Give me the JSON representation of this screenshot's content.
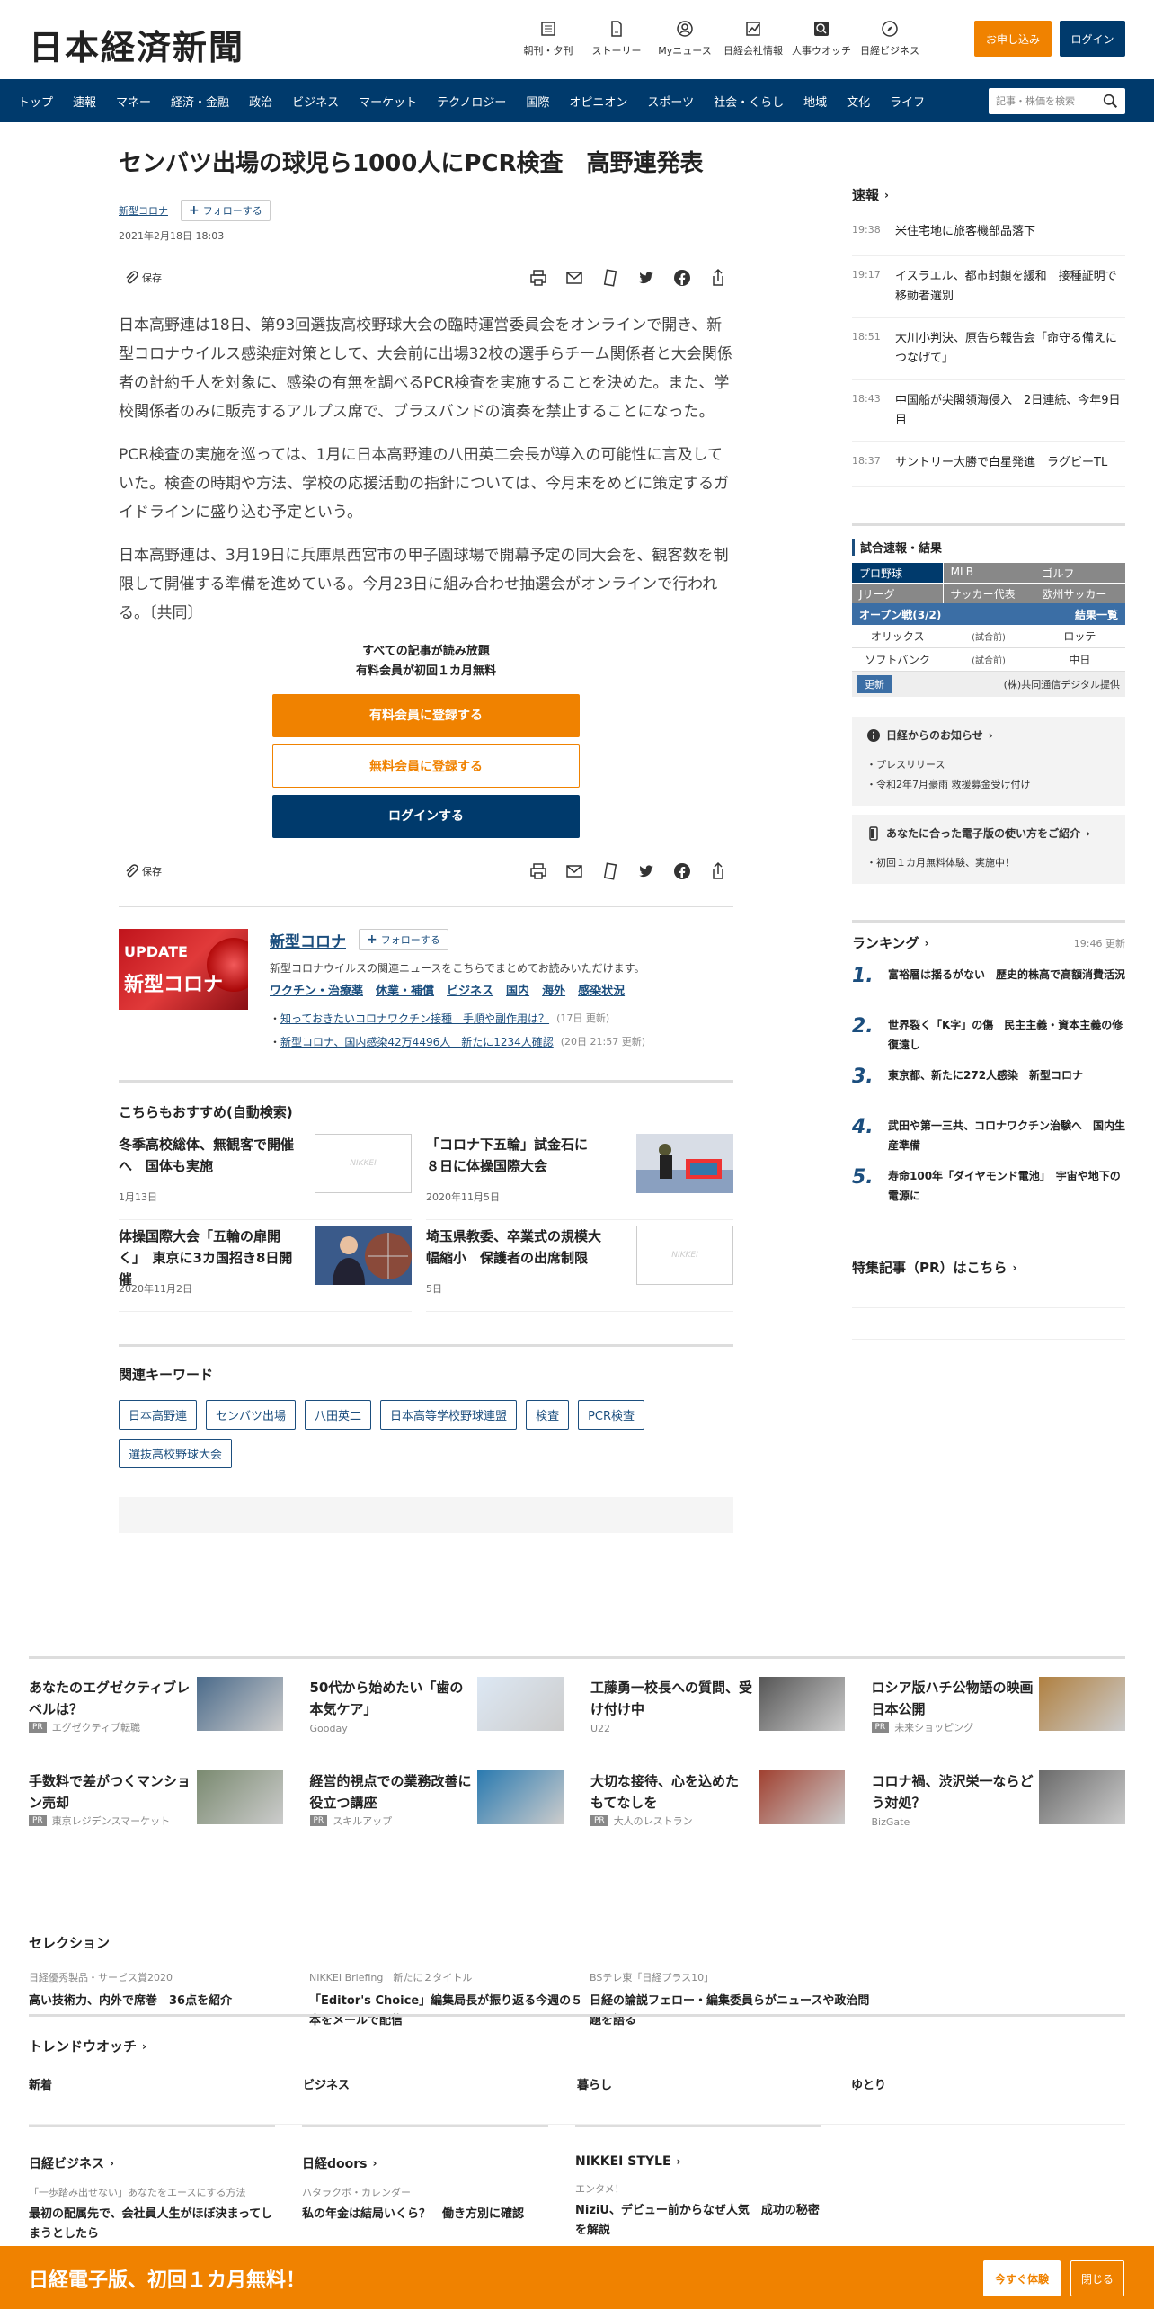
{
  "header": {
    "logo": "日本経済新聞",
    "tools": [
      {
        "label": "朝刊・夕刊",
        "icon": "newspaper-icon"
      },
      {
        "label": "ストーリー",
        "icon": "document-icon"
      },
      {
        "label": "Myニュース",
        "icon": "user-icon"
      },
      {
        "label": "日経会社情報",
        "icon": "chart-icon"
      },
      {
        "label": "人事ウオッチ",
        "icon": "search-person-icon"
      },
      {
        "label": "日経ビジネス",
        "icon": "compass-icon"
      }
    ],
    "subscribe_label": "お申し込み",
    "login_label": "ログイン"
  },
  "nav": {
    "items": [
      "トップ",
      "速報",
      "マネー",
      "経済・金融",
      "政治",
      "ビジネス",
      "マーケット",
      "テクノロジー",
      "国際",
      "オピニオン",
      "スポーツ",
      "社会・くらし",
      "地域",
      "文化",
      "ライフ"
    ],
    "search_placeholder": "記事・株価を検索"
  },
  "article": {
    "title": "センバツ出場の球児ら1000人にPCR検査　高野連発表",
    "topic": "新型コロナ",
    "follow_label": "フォローする",
    "date": "2021年2月18日 18:03",
    "save_label": "保存",
    "paragraphs": [
      "日本高野連は18日、第93回選抜高校野球大会の臨時運営委員会をオンラインで開き、新型コロナウイルス感染症対策として、大会前に出場32校の選手らチーム関係者と大会関係者の計約千人を対象に、感染の有無を調べるPCR検査を実施することを決めた。また、学校関係者のみに販売するアルプス席で、ブラスバンドの演奏を禁止することになった。",
      "PCR検査の実施を巡っては、1月に日本高野連の八田英二会長が導入の可能性に言及していた。検査の時期や方法、学校の応援活動の指針については、今月末をめどに策定するガイドラインに盛り込む予定という。",
      "日本高野連は、3月19日に兵庫県西宮市の甲子園球場で開幕予定の同大会を、観客数を制限して開催する準備を進めている。今月23日に組み合わせ抽選会がオンラインで行われる。〔共同〕"
    ]
  },
  "paywall": {
    "line1": "すべての記事が読み放題",
    "line2": "有料会員が初回１カ月無料",
    "paid_label": "有料会員に登録する",
    "free_label": "無料会員に登録する",
    "login_label": "ログインする"
  },
  "topic_box": {
    "img_update": "UPDATE",
    "img_name": "新型コロナ",
    "name": "新型コロナ",
    "follow_label": "フォローする",
    "desc": "新型コロナウイルスの関連ニュースをこちらでまとめてお読みいただけます。",
    "keys": [
      "ワクチン・治療薬",
      "休業・補償",
      "ビジネス",
      "国内",
      "海外",
      "感染状況"
    ],
    "links": [
      {
        "text": "知っておきたいコロナワクチン接種　手順や副作用は？",
        "date": "(17日 更新)"
      },
      {
        "text": "新型コロナ、国内感染42万4496人　新たに1234人確認",
        "date": "(20日 21:57 更新)"
      }
    ]
  },
  "recommend": {
    "heading": "こちらもおすすめ(自動検索)",
    "placeholder_logo": "NIKKEI",
    "items": [
      {
        "title": "冬季高校総体、無観客で開催へ　国体も実施",
        "date": "1月13日",
        "img": "placeholder"
      },
      {
        "title": "「コロナ下五輪」試金石に　８日に体操国際大会",
        "date": "2020年11月5日",
        "img": "photo-gym"
      },
      {
        "title": "体操国際大会「五輪の扉開く」　東京に3カ国招き8日開催",
        "date": "2020年11月2日",
        "img": "photo-man"
      },
      {
        "title": "埼玉県教委、卒業式の規模大幅縮小　保護者の出席制限",
        "date": "5日",
        "img": "placeholder"
      }
    ]
  },
  "keywords": {
    "heading": "関連キーワード",
    "items": [
      "日本高野連",
      "センバツ出場",
      "八田英二",
      "日本高等学校野球連盟",
      "検査",
      "PCR検査",
      "選抜高校野球大会"
    ]
  },
  "sidebar": {
    "flash_heading": "速報",
    "flash": [
      {
        "time": "19:38",
        "text": "米住宅地に旅客機部品落下"
      },
      {
        "time": "19:17",
        "text": "イスラエル、都市封鎖を緩和　接種証明で移動者選別"
      },
      {
        "time": "18:51",
        "text": "大川小判決、原告ら報告会「命守る備えにつなげて」"
      },
      {
        "time": "18:43",
        "text": "中国船が尖閣領海侵入　2日連続、今年9日目"
      },
      {
        "time": "18:37",
        "text": "サントリー大勝で白星発進　ラグビーTL"
      }
    ],
    "scores": {
      "heading": "試合速報・結果",
      "tabs": [
        "プロ野球",
        "MLB",
        "ゴルフ",
        "Jリーグ",
        "サッカー代表",
        "欧州サッカー"
      ],
      "title": "オープン戦(3/2)",
      "results_label": "結果一覧",
      "games": [
        {
          "home": "オリックス",
          "mid": "(試合前)",
          "away": "ロッテ"
        },
        {
          "home": "ソフトバンク",
          "mid": "(試合前)",
          "away": "中日"
        }
      ],
      "update_label": "更新",
      "provider": "(株)共同通信デジタル提供"
    },
    "notice": {
      "heading": "日経からのお知らせ",
      "items": [
        "プレスリリース",
        "令和2年7月豪雨 救援募金受け付け"
      ]
    },
    "guide": {
      "heading": "あなたに合った電子版の使い方をご紹介",
      "items": [
        "初回１カ月無料体験、実施中！"
      ]
    },
    "ranking": {
      "heading": "ランキング",
      "updated": "19:46 更新",
      "items": [
        {
          "num": "1.",
          "text": "富裕層は揺るがない　歴史的株高で高額消費活況"
        },
        {
          "num": "2.",
          "text": "世界裂く「K字」の傷　民主主義・資本主義の修復遠し"
        },
        {
          "num": "3.",
          "text": "東京都、新たに272人感染　新型コロナ"
        },
        {
          "num": "4.",
          "text": "武田や第一三共、コロナワクチン治験へ　国内生産準備"
        },
        {
          "num": "5.",
          "text": "寿命100年「ダイヤモンド電池」　宇宙や地下の電源に"
        }
      ]
    },
    "pr_heading": "特集記事（PR）はこちら"
  },
  "ads": {
    "pr_badge": "PR",
    "items": [
      {
        "title": "あなたのエグゼクティブレベルは？",
        "sponsor": "エグゼクティブ転職",
        "pr": true
      },
      {
        "title": "50代から始めたい「歯の本気ケア」",
        "sponsor": "Gooday",
        "pr": false
      },
      {
        "title": "工藤勇一校長への質問、受け付け中",
        "sponsor": "U22",
        "pr": false
      },
      {
        "title": "ロシア版ハチ公物語の映画日本公開",
        "sponsor": "未来ショッピング",
        "pr": true
      },
      {
        "title": "手数料で差がつくマンション売却",
        "sponsor": "東京レジデンスマーケット",
        "pr": true
      },
      {
        "title": "経営的視点での業務改善に役立つ講座",
        "sponsor": "スキルアップ",
        "pr": true
      },
      {
        "title": "大切な接待、心を込めたもてなしを",
        "sponsor": "大人のレストラン",
        "pr": true
      },
      {
        "title": "コロナ禍、渋沢栄一ならどう対処？",
        "sponsor": "BizGate",
        "pr": false
      }
    ]
  },
  "selection": {
    "heading": "セレクション",
    "items": [
      {
        "sub": "日経優秀製品・サービス賞2020",
        "title": "高い技術力、内外で席巻　36点を紹介"
      },
      {
        "sub": "NIKKEI Briefing　新たに２タイトル",
        "title": "「Editor's Choice」編集局長が振り返る今週の５本をメールで配信"
      },
      {
        "sub": "BSテレ東「日経プラス10」",
        "title": "日経の論説フェロー・編集委員らがニュースや政治問題を語る"
      }
    ]
  },
  "trend": {
    "heading": "トレンドウオッチ",
    "items": [
      "新着",
      "ビジネス",
      "暮らし",
      "ゆとり"
    ]
  },
  "media": [
    {
      "heading": "日経ビジネス",
      "sub": "「一歩踏み出せない」あなたをエースにする方法",
      "title": "最初の配属先で、会社員人生がほぼ決まってしまうとしたら"
    },
    {
      "heading": "日経doors",
      "sub": "ハタラクボ・カレンダー",
      "title": "私の年金は結局いくら？　働き方別に確認"
    },
    {
      "heading": "NIKKEI STYLE",
      "sub": "エンタメ！",
      "title": "NiziU、デビュー前からなぜ人気　成功の秘密を解説"
    }
  ],
  "banner": {
    "text": "日経電子版、初回１カ月無料！",
    "try_label": "今すぐ体験",
    "close_label": "閉じる"
  }
}
